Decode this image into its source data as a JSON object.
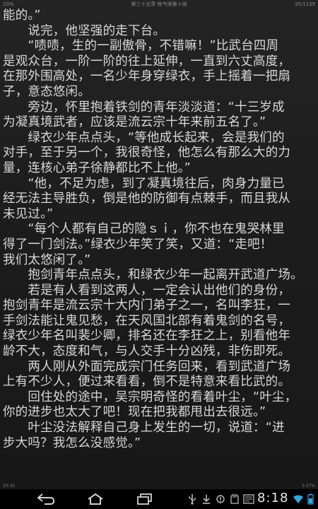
{
  "status": {
    "battery": "20%",
    "chapter_title": "第三十五章 练气境第十层",
    "page_progress": "35/1139",
    "time_left": "20:35",
    "percent_right": "3.07%"
  },
  "content": {
    "lines": [
      "能的。”",
      "　　说完，他坚强的走下台。",
      "　　“啧啧，生的一副傲骨，不错嘛！”比武台四周",
      "是观众台，一阶一阶的往上延伸，一直到六丈高度，",
      "在那外围高处，一名少年身穿绿衣，手上摇着一把扇",
      "子，意态悠闲。",
      "　　旁边，怀里抱着铁剑的青年淡淡道：“十三岁成",
      "为凝真境武者，应该是流云宗十年来前五名了。”",
      "　　绿衣少年点点头，“等他成长起来，会是我们的",
      "对手，至于另一个，我很奇怪，他怎么有那么大的力",
      "量，连核心弟子徐静都比不上他。”",
      "　　“他，不足为虑，到了凝真境往后，肉身力量已",
      "经无法主导胜负，倒是他的防御有点棘手，而且我从",
      "未见过。”",
      "　　“每个人都有自己的隐ｓｉ，你不也在鬼哭林里",
      "得了一门剑法。”绿衣少年笑了笑，又道：“走吧！",
      "我们太悠闲了。”",
      "　　抱剑青年点点头，和绿衣少年一起离开武道广场。",
      "　　若是有人看到这两人，一定会认出他们的身份，",
      "抱剑青年是流云宗十大内门弟子之一，名叫李狂，一",
      "手剑法能让鬼见愁，在天风国北部有着鬼剑的名号，",
      "绿衣少年名叫裴少卿，排名还在李狂之上，别看他年",
      "龄不大，态度和气，与人交手十分凶残，非伤即死。",
      "　　两人刚从外面完成宗门任务回来，看到武道广场",
      "上有不少人，便过来看看，倒不是特意来看比武的。",
      "　　回住处的途中，吴宗明奇怪的看着叶尘，“叶尘，",
      "你的进步也太大了吧！现在把我都甩出去很远。”",
      "　　叶尘没法解释自己身上发生的一切，说道：“进",
      "步大吗？我怎么没感觉。”"
    ]
  },
  "system": {
    "clock": "8:18",
    "icons": {
      "back": "back-arrow-icon",
      "home": "home-icon",
      "recent": "recent-apps-icon",
      "usb": "usb-icon",
      "download": "download-icon",
      "notify": "notification-icon",
      "sd": "sd-card-icon",
      "wifi": "wifi-icon",
      "battery": "battery-icon"
    },
    "accent": "#2ea8e6"
  }
}
